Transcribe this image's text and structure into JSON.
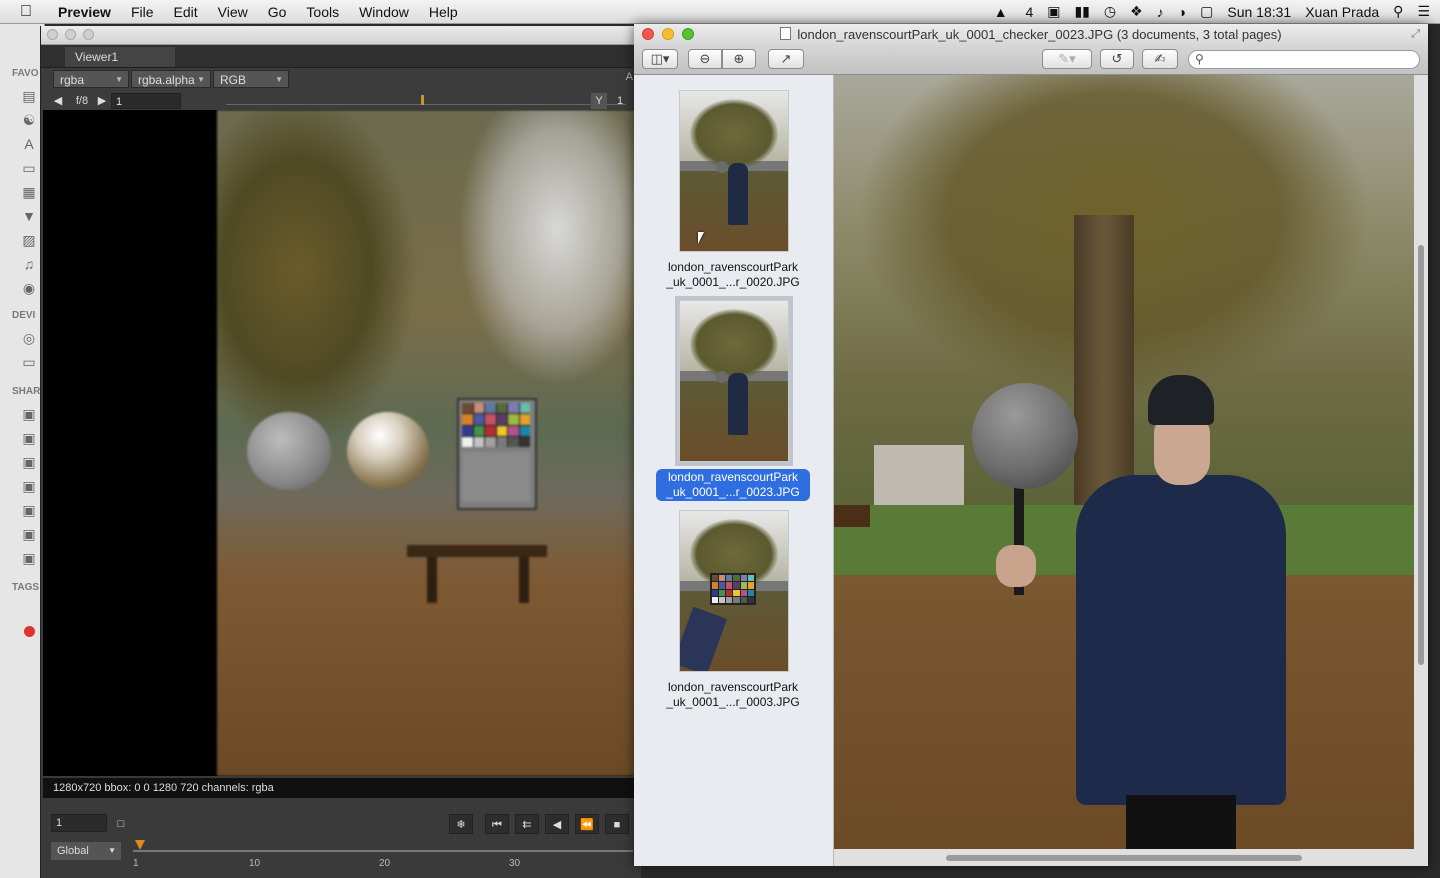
{
  "menubar": {
    "apple_icon": "apple-icon",
    "app_name": "Preview",
    "menus": [
      "File",
      "Edit",
      "View",
      "Go",
      "Tools",
      "Window",
      "Help"
    ],
    "status": {
      "adobe_label": "4",
      "clock": "Sun 18:31",
      "user": "Xuan Prada"
    }
  },
  "finder": {
    "sections": [
      "FAVO",
      "DEVI",
      "SHAR",
      "TAGS"
    ]
  },
  "nuke": {
    "tab_label": "Viewer1",
    "channels_select": "rgba",
    "alpha_select": "rgba.alpha",
    "colorspace_select": "RGB",
    "right_label": "A",
    "fstop": "f/8",
    "frame_field": "1",
    "y_label": "Y",
    "y_value": "1",
    "info_text": "1280x720 bbox: 0 0 1280 720 channels: rgba",
    "current_frame": "1",
    "range_select": "Global",
    "timeline_ticks": [
      "1",
      "10",
      "20",
      "30"
    ]
  },
  "preview": {
    "window_title": "london_ravenscourtPark_uk_0001_checker_0023.JPG (3 documents, 3 total pages)",
    "search_placeholder": "",
    "thumbnails": [
      {
        "line1": "london_ravenscourtPark",
        "line2": "_uk_0001_...r_0020.JPG",
        "selected": false
      },
      {
        "line1": "london_ravenscourtPark",
        "line2": "_uk_0001_...r_0023.JPG",
        "selected": true
      },
      {
        "line1": "london_ravenscourtPark",
        "line2": "_uk_0001_...r_0003.JPG",
        "selected": false
      }
    ]
  },
  "colors": {
    "selection_blue": "#2f6ee0",
    "close_red": "#f25650",
    "minimize_yellow": "#f6be2f",
    "zoom_green": "#56c22f",
    "playhead_orange": "#e08a1e"
  }
}
